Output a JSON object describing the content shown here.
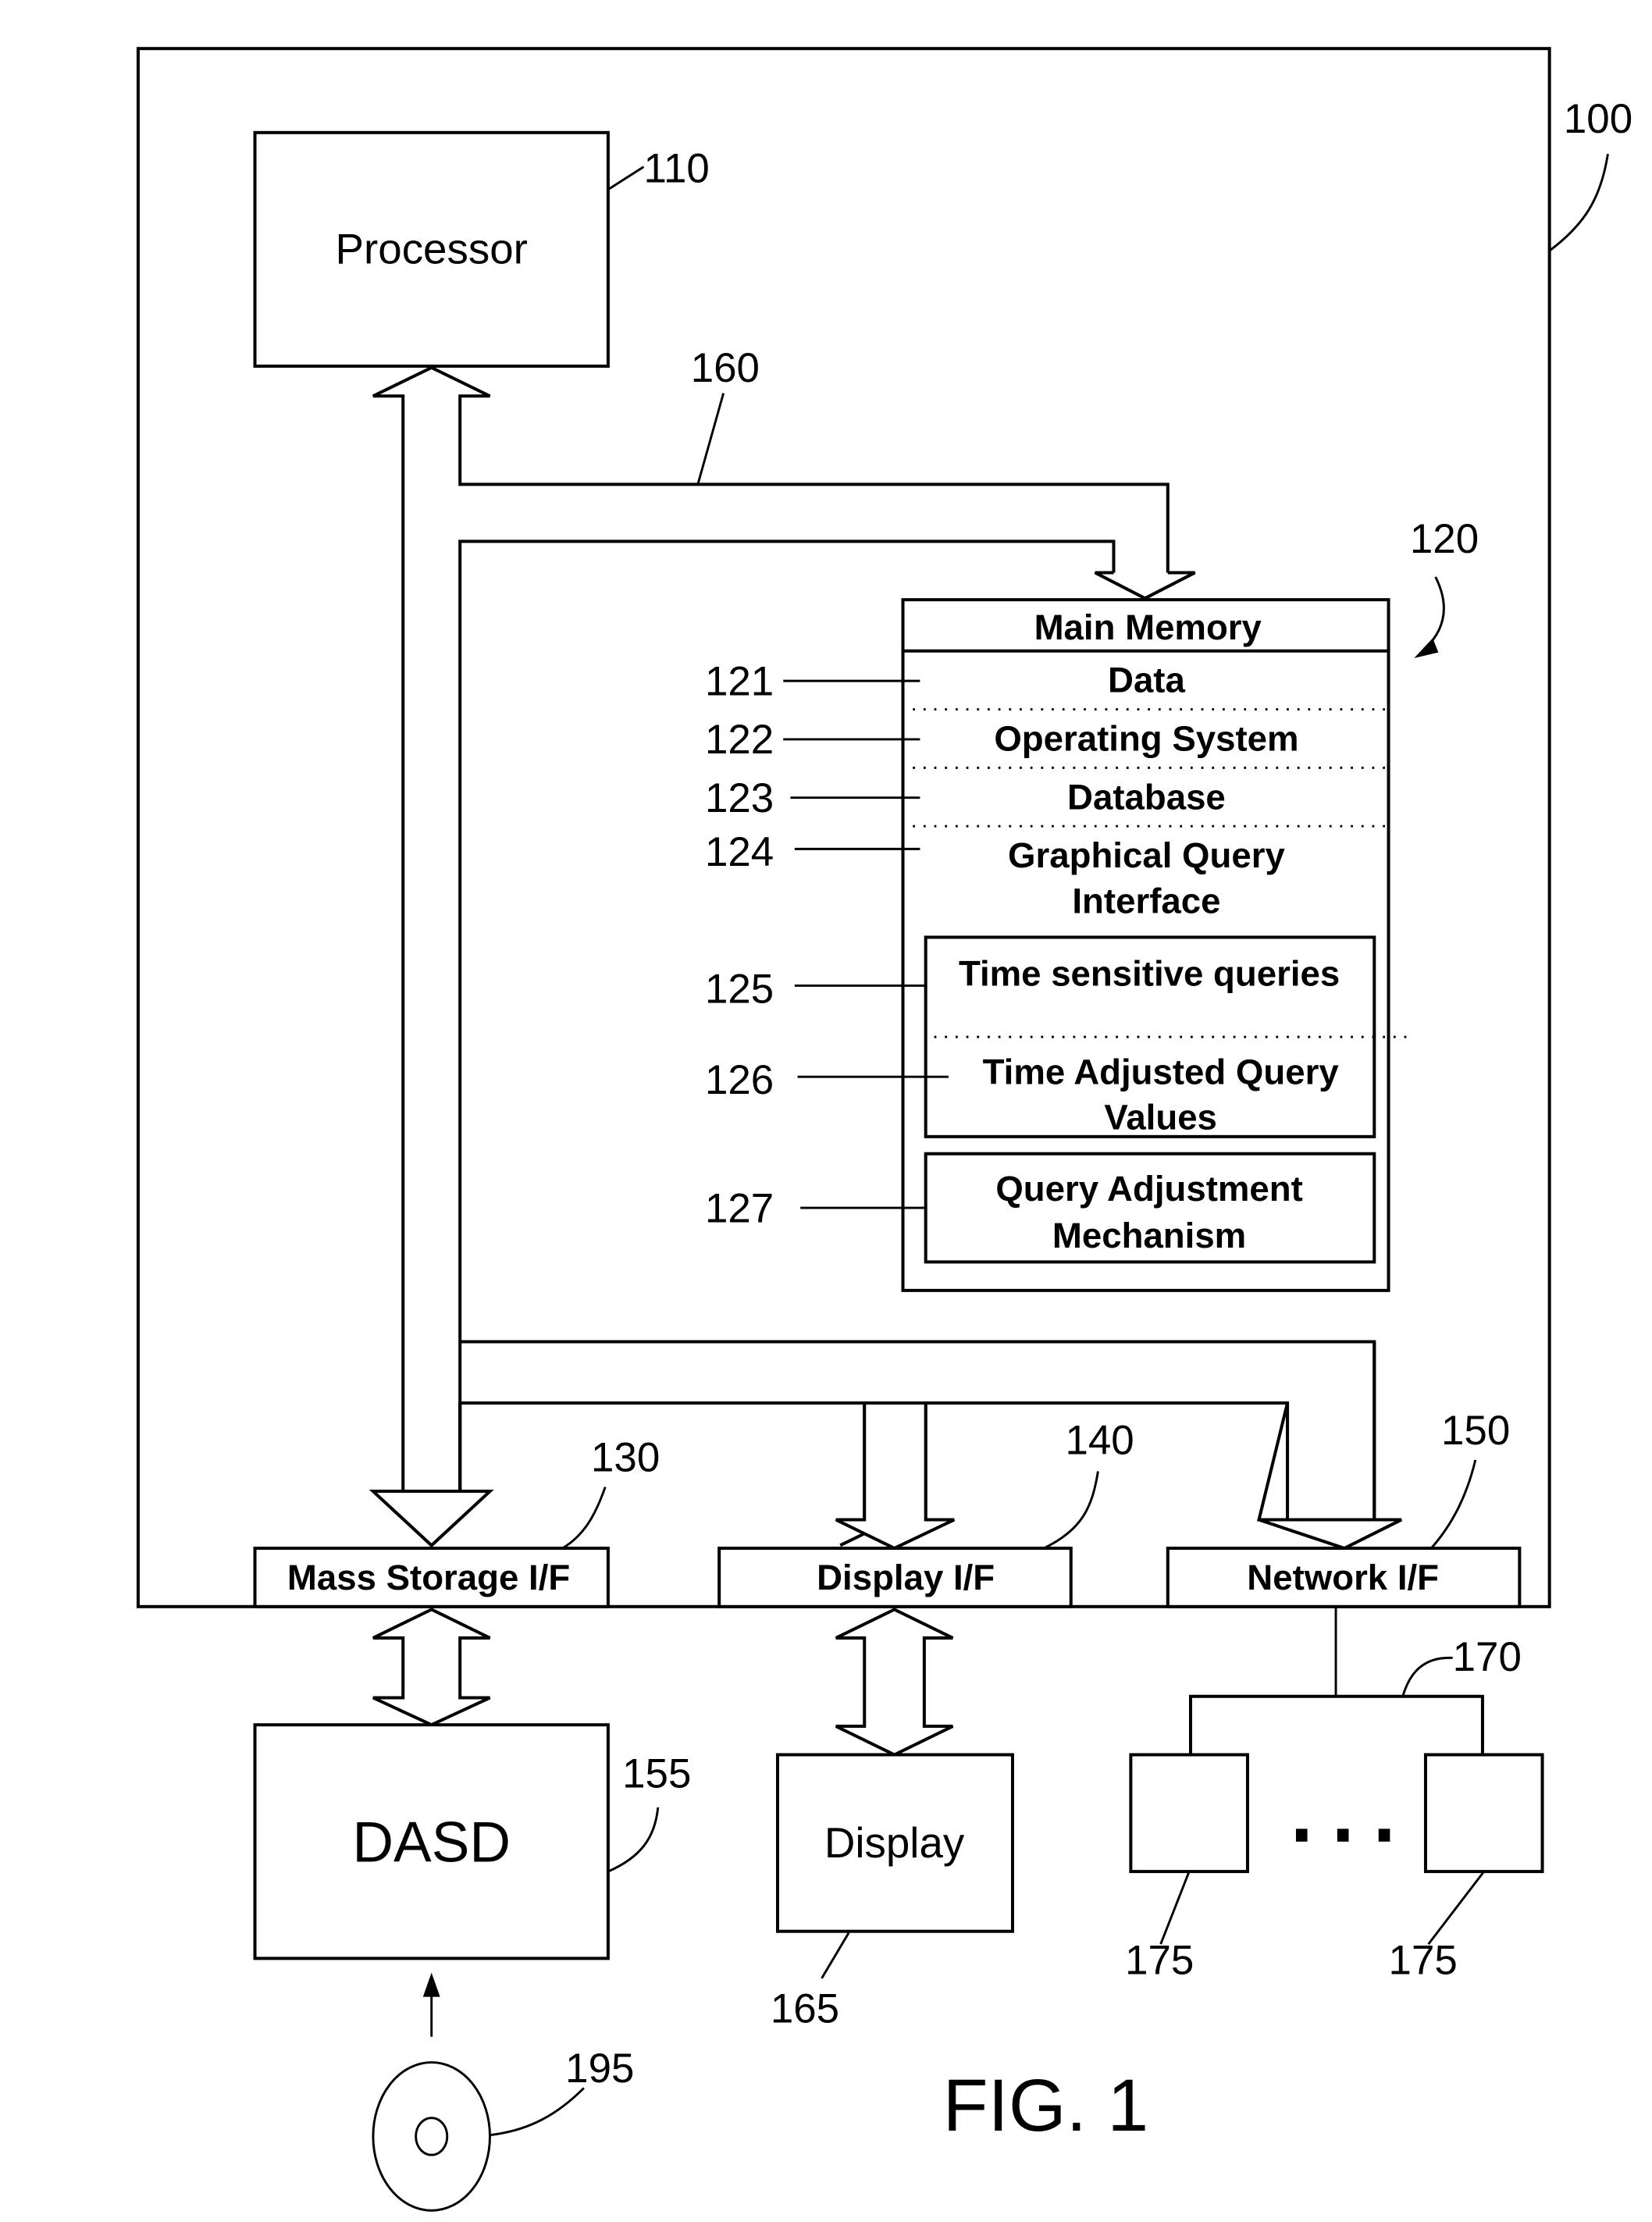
{
  "figure": {
    "caption": "FIG. 1",
    "system_ref": "100"
  },
  "components": {
    "processor": {
      "label": "Processor",
      "ref": "110"
    },
    "bus": {
      "ref": "160"
    },
    "main_memory": {
      "label": "Main Memory",
      "ref": "120",
      "sections": [
        {
          "ref": "121",
          "label": "Data"
        },
        {
          "ref": "122",
          "label": "Operating System"
        },
        {
          "ref": "123",
          "label": "Database"
        },
        {
          "ref": "124",
          "label_lines": [
            "Graphical Query",
            "Interface"
          ]
        }
      ],
      "gqi_subitems": [
        {
          "ref": "125",
          "label": "Time sensitive queries"
        },
        {
          "ref": "126",
          "label_lines": [
            "Time Adjusted Query",
            "Values"
          ]
        }
      ],
      "mechanism": {
        "ref": "127",
        "label_lines": [
          "Query Adjustment",
          "Mechanism"
        ]
      }
    },
    "interfaces": [
      {
        "ref": "130",
        "label": "Mass Storage I/F"
      },
      {
        "ref": "140",
        "label": "Display I/F"
      },
      {
        "ref": "150",
        "label": "Network I/F"
      }
    ],
    "dasd": {
      "label": "DASD",
      "ref": "155"
    },
    "display": {
      "label": "Display",
      "ref": "165"
    },
    "network": {
      "ref": "170",
      "node_ref_left": "175",
      "node_ref_right": "175",
      "ellipsis": "• • •"
    },
    "media": {
      "ref": "195"
    }
  }
}
